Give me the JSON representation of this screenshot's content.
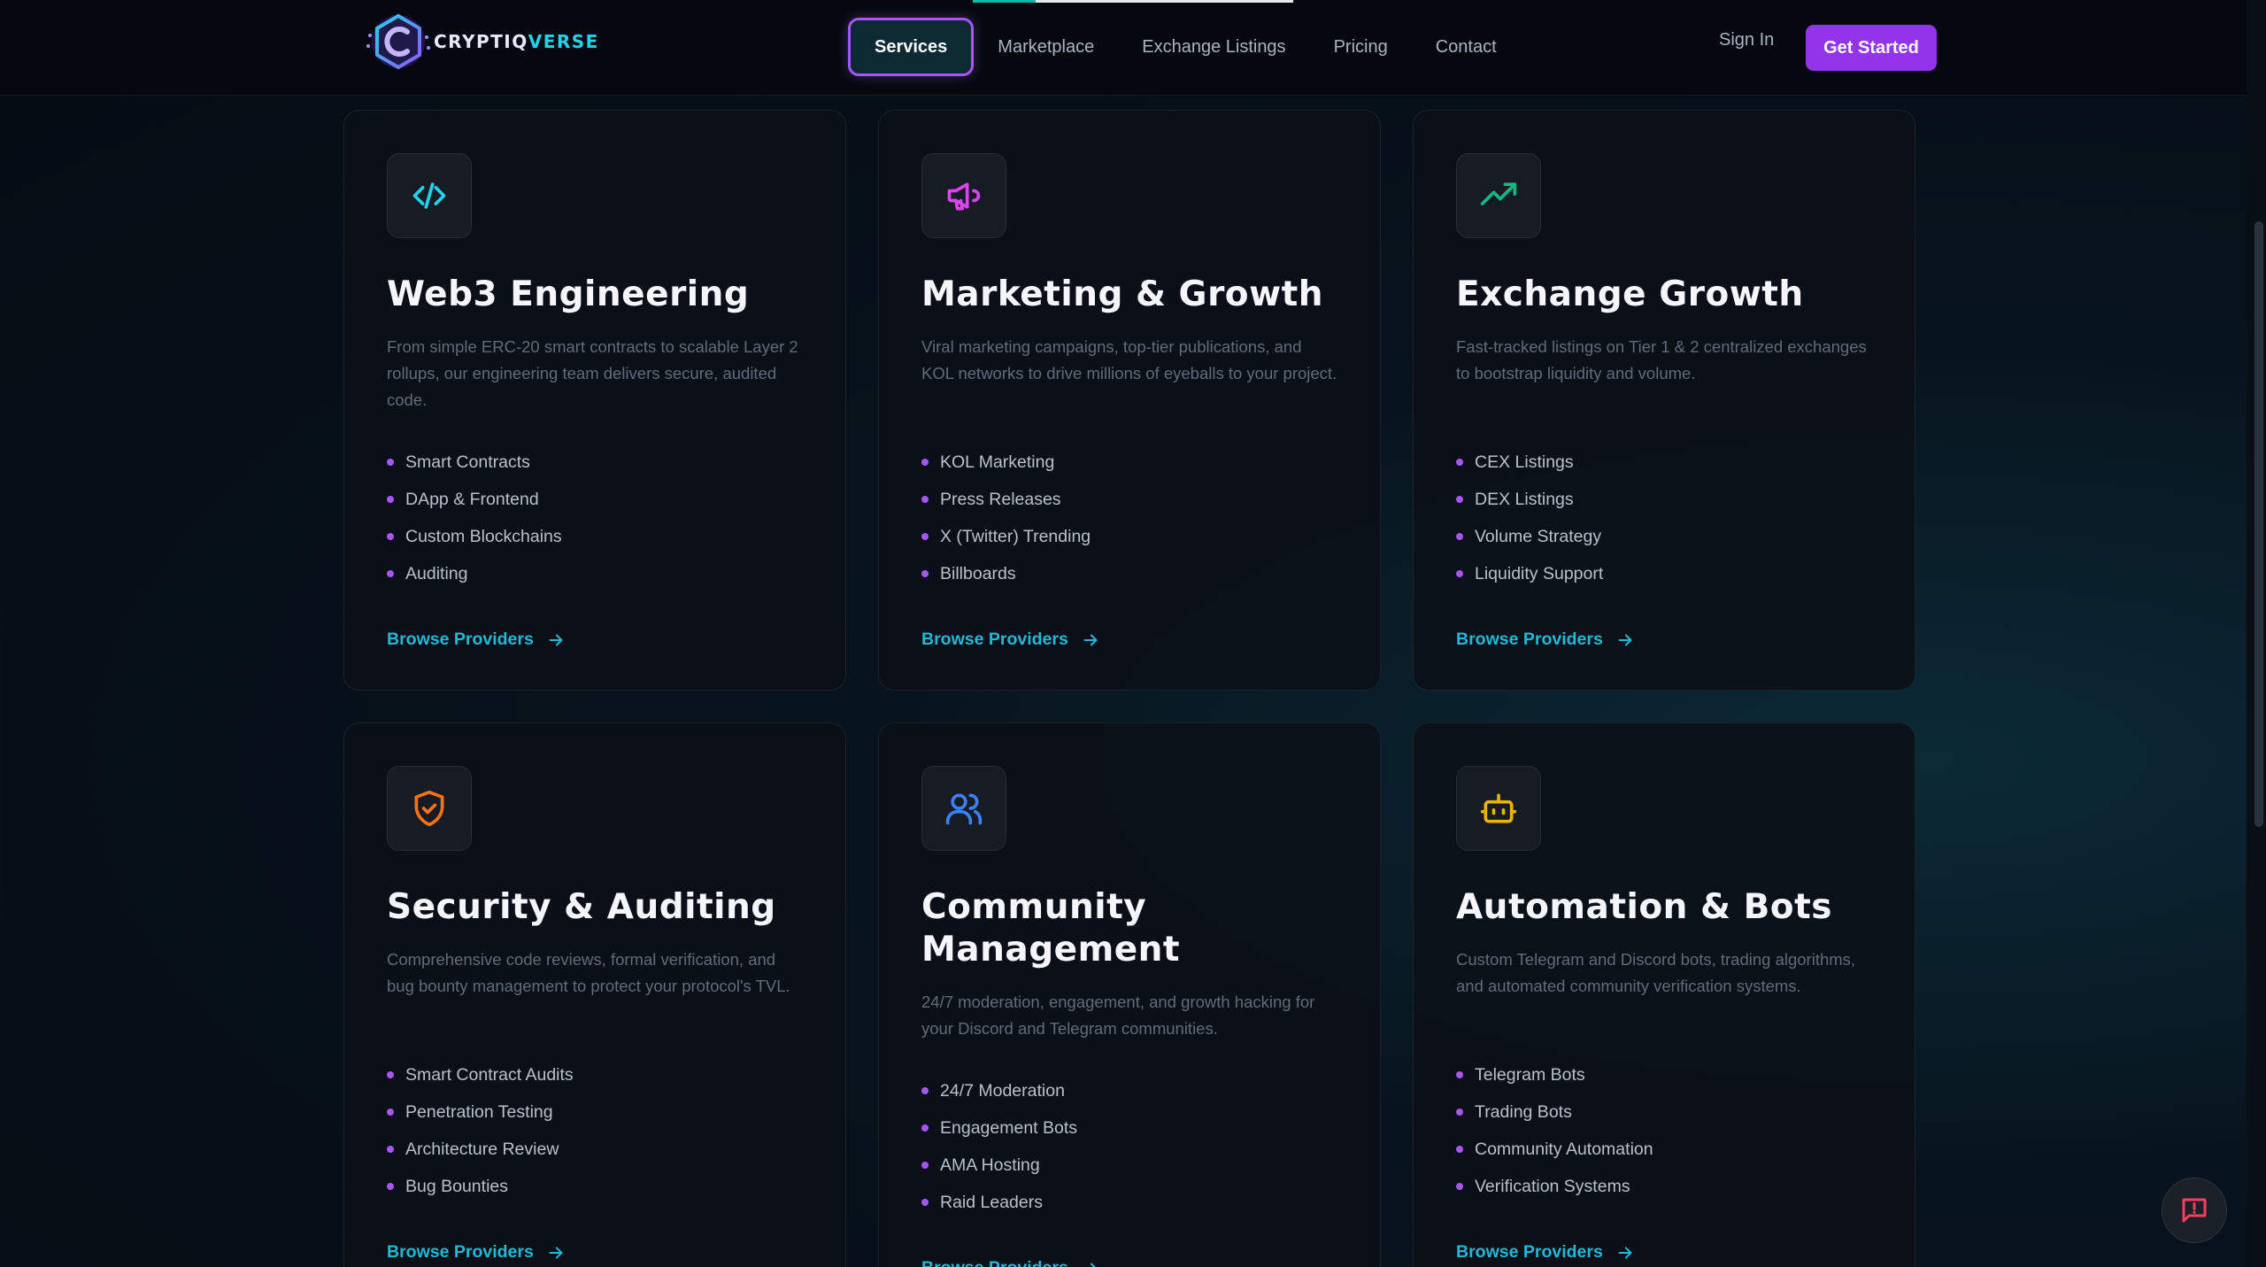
{
  "brand": {
    "name_main": "CRYPTIQ",
    "name_accent": "VERSE"
  },
  "nav": {
    "links": [
      "Services",
      "Marketplace",
      "Exchange Listings",
      "Pricing",
      "Contact"
    ],
    "active": "Services",
    "sign_in": "Sign In",
    "cta": "Get Started"
  },
  "colors": {
    "accent_purple": "#a855f7",
    "accent_cyan": "#22b8d6",
    "background": "#060b13"
  },
  "cards": [
    {
      "icon": "code-icon",
      "icon_color": "#22d3ee",
      "title": "Web3 Engineering",
      "description": "From simple ERC-20 smart contracts to scalable Layer 2 rollups, our engineering team delivers secure, audited code.",
      "features": [
        "Smart Contracts",
        "DApp & Frontend",
        "Custom Blockchains",
        "Auditing"
      ],
      "link": "Browse Providers"
    },
    {
      "icon": "megaphone-icon",
      "icon_color": "#d946ef",
      "title": "Marketing & Growth",
      "description": "Viral marketing campaigns, top-tier publications, and KOL networks to drive millions of eyeballs to your project.",
      "features": [
        "KOL Marketing",
        "Press Releases",
        "X (Twitter) Trending",
        "Billboards"
      ],
      "link": "Browse Providers"
    },
    {
      "icon": "trending-up-icon",
      "icon_color": "#10b981",
      "title": "Exchange Growth",
      "description": "Fast-tracked listings on Tier 1 & 2 centralized exchanges to bootstrap liquidity and volume.",
      "features": [
        "CEX Listings",
        "DEX Listings",
        "Volume Strategy",
        "Liquidity Support"
      ],
      "link": "Browse Providers"
    },
    {
      "icon": "shield-check-icon",
      "icon_color": "#f97316",
      "title": "Security & Auditing",
      "description": "Comprehensive code reviews, formal verification, and bug bounty management to protect your protocol's TVL.",
      "features": [
        "Smart Contract Audits",
        "Penetration Testing",
        "Architecture Review",
        "Bug Bounties"
      ],
      "link": "Browse Providers"
    },
    {
      "icon": "users-icon",
      "icon_color": "#3b82f6",
      "title": "Community Management",
      "description": "24/7 moderation, engagement, and growth hacking for your Discord and Telegram communities.",
      "features": [
        "24/7 Moderation",
        "Engagement Bots",
        "AMA Hosting",
        "Raid Leaders"
      ],
      "link": "Browse Providers"
    },
    {
      "icon": "bot-icon",
      "icon_color": "#eab308",
      "title": "Automation & Bots",
      "description": "Custom Telegram and Discord bots, trading algorithms, and automated community verification systems.",
      "features": [
        "Telegram Bots",
        "Trading Bots",
        "Community Automation",
        "Verification Systems"
      ],
      "link": "Browse Providers"
    }
  ],
  "feedback": {
    "icon": "message-alert-icon"
  }
}
